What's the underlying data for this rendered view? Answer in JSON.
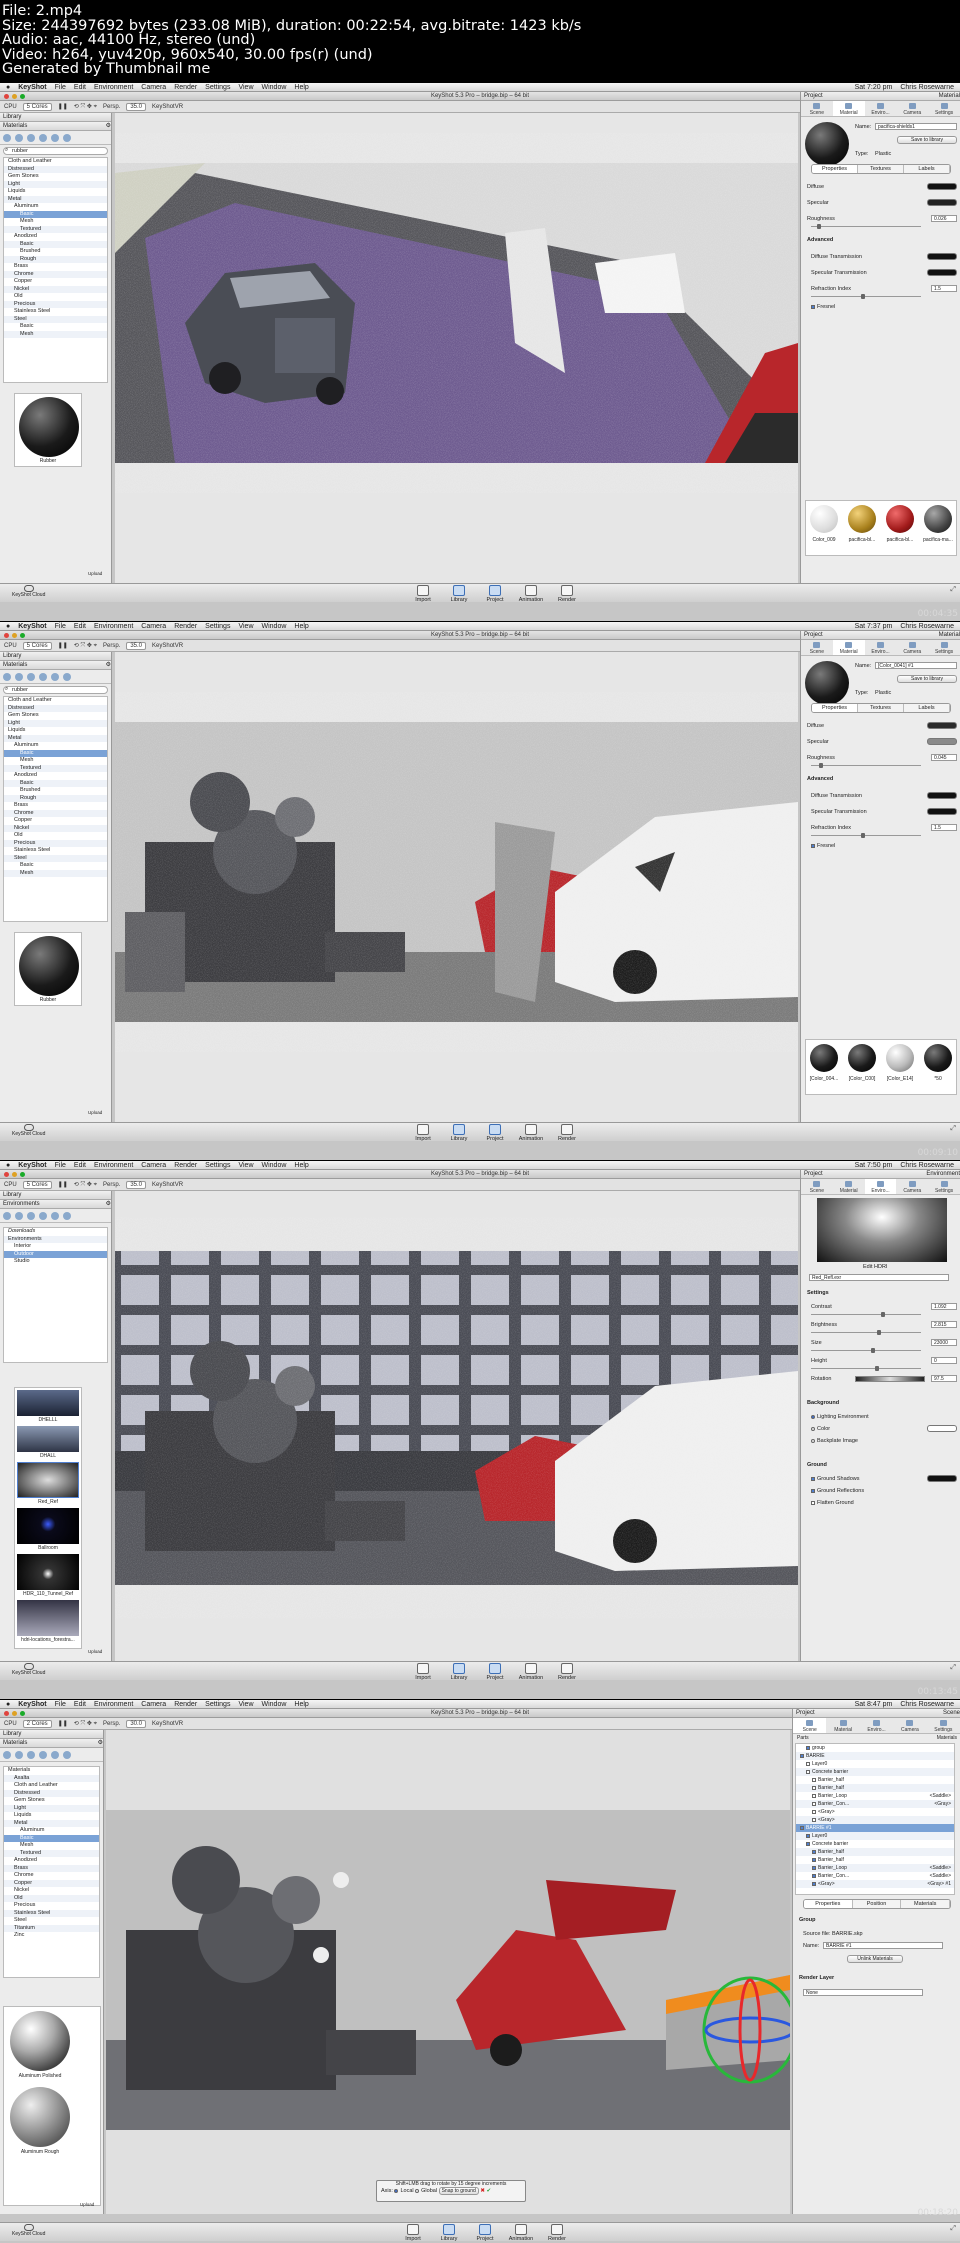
{
  "header": {
    "lines": [
      "File: 2.mp4",
      "Size: 244397692 bytes (233.08 MiB), duration: 00:22:54, avg.bitrate: 1423 kb/s",
      "Audio: aac, 44100 Hz, stereo (und)",
      "Video: h264, yuv420p, 960x540, 30.00 fps(r) (und)",
      "Generated by Thumbnail me"
    ]
  },
  "menu": {
    "app": "KeyShot",
    "items": [
      "File",
      "Edit",
      "Environment",
      "Camera",
      "Render",
      "Settings",
      "View",
      "Window",
      "Help"
    ],
    "user": "Chris Rosewarne"
  },
  "toolbar": {
    "cpu": "CPU",
    "persp": "Persp.",
    "keyshotvr": "KeyShotVR"
  },
  "bottom": {
    "cloud": "KeyShot Cloud",
    "items": [
      "Import",
      "Library",
      "Project",
      "Animation",
      "Render"
    ]
  },
  "colors": {
    "accent": "#4f7fd0",
    "selection": "#7aa2d6",
    "mesh_red": "#b8262b"
  },
  "frames": [
    {
      "time_label": "Sat 7:20 pm",
      "timecode": "00:04:35",
      "window_title": "KeyShot 5.3 Pro – bridge.bip – 64 bit",
      "cores": "5 Cores",
      "persp_value": "35.0",
      "left": {
        "title": "Library",
        "tab": "Materials",
        "search": "rubber",
        "tree": [
          "Cloth and Leather",
          "Distressed",
          "Gem Stones",
          "Light",
          "Liquids",
          "Metal",
          "Aluminum",
          "Basic",
          "Mesh",
          "Textured",
          "Anodized",
          "Basic",
          "Brushed",
          "Rough",
          "Brass",
          "Chrome",
          "Copper",
          "Nickel",
          "Old",
          "Precious",
          "Stainless Steel",
          "Steel",
          "Basic",
          "Mesh"
        ],
        "thumb_label": "Rubber",
        "count": "Upload"
      },
      "right": {
        "title": "Project",
        "tab": "Material",
        "tabs": [
          "Scene",
          "Material",
          "Enviro...",
          "Camera",
          "Settings"
        ],
        "name_label": "Name:",
        "name_value": "pacifica-shields1",
        "save_btn": "Save to library",
        "type_label": "Type:",
        "type_value": "Plastic",
        "seg": [
          "Properties",
          "Textures",
          "Labels"
        ],
        "props": [
          "Diffuse",
          "Specular",
          "Roughness"
        ],
        "rough_value": "0.026",
        "advanced": "Advanced",
        "adv": [
          "Diffuse Transmission",
          "Specular Transmission",
          "Refraction Index"
        ],
        "ri_value": "1.5",
        "fresnel": "Fresnel",
        "swatches": [
          "Color_009",
          "pacifica-bl...",
          "pacifica-bl...",
          "pacifica-ma..."
        ]
      }
    },
    {
      "time_label": "Sat 7:37 pm",
      "timecode": "00:09:10",
      "window_title": "KeyShot 5.3 Pro – bridge.bip – 64 bit",
      "cores": "5 Cores",
      "persp_value": "35.0",
      "left": {
        "title": "Library",
        "tab": "Materials",
        "search": "rubber",
        "tree": [
          "Cloth and Leather",
          "Distressed",
          "Gem Stones",
          "Light",
          "Liquids",
          "Metal",
          "Aluminum",
          "Basic",
          "Mesh",
          "Textured",
          "Anodized",
          "Basic",
          "Brushed",
          "Rough",
          "Brass",
          "Chrome",
          "Copper",
          "Nickel",
          "Old",
          "Precious",
          "Stainless Steel",
          "Steel",
          "Basic",
          "Mesh"
        ],
        "thumb_label": "Rubber",
        "count": "Upload"
      },
      "right": {
        "title": "Project",
        "tab": "Material",
        "tabs": [
          "Scene",
          "Material",
          "Enviro...",
          "Camera",
          "Settings"
        ],
        "name_label": "Name:",
        "name_value": "[Color_0041] #1",
        "save_btn": "Save to library",
        "type_label": "Type:",
        "type_value": "Plastic",
        "seg": [
          "Properties",
          "Textures",
          "Labels"
        ],
        "props": [
          "Diffuse",
          "Specular",
          "Roughness"
        ],
        "rough_value": "0.045",
        "advanced": "Advanced",
        "adv": [
          "Diffuse Transmission",
          "Specular Transmission",
          "Refraction Index"
        ],
        "ri_value": "1.5",
        "fresnel": "Fresnel",
        "swatches": [
          "[Color_004...",
          "[Color_C00]",
          "[Color_E14]",
          "*50"
        ]
      }
    },
    {
      "time_label": "Sat 7:50 pm",
      "timecode": "00:13:45",
      "window_title": "KeyShot 5.3 Pro – bridge.bip – 64 bit",
      "cores": "5 Cores",
      "persp_value": "35.0",
      "left": {
        "title": "Library",
        "tab": "Environments",
        "tree": [
          "Downloads",
          "Environments",
          "Interior",
          "Outdoor",
          "Studio"
        ],
        "thumbs": [
          "DHELLL",
          "DHALL",
          "Red_Ref",
          "Ballroom",
          "HDR_110_Tunnel_Ref",
          "hdri-locations_forestra..."
        ],
        "count": "Upload"
      },
      "right": {
        "title": "Project",
        "tab": "Environment",
        "tabs": [
          "Scene",
          "Material",
          "Enviro...",
          "Camera",
          "Settings"
        ],
        "edit_hdri": "Edit HDRI",
        "env_name": "Red_Refl.exr",
        "settings": "Settings",
        "rows": [
          {
            "label": "Contrast",
            "value": "1.092"
          },
          {
            "label": "Brightness",
            "value": "2.815"
          },
          {
            "label": "Size",
            "value": "23000"
          },
          {
            "label": "Height",
            "value": "0"
          },
          {
            "label": "Rotation",
            "value": "97.5"
          }
        ],
        "background": "Background",
        "bg_opts": [
          "Lighting Environment",
          "Color",
          "Backplate Image"
        ],
        "ground": "Ground",
        "ground_opts": [
          "Ground Shadows",
          "Ground Reflections",
          "Flatten Ground"
        ]
      }
    },
    {
      "time_label": "Sat 8:47 pm",
      "timecode": "00:18:20",
      "window_title": "KeyShot 5.3 Pro – bridge.bip – 64 bit",
      "cores": "2 Cores",
      "persp_value": "30.0",
      "left": {
        "title": "Library",
        "tab": "Materials",
        "tree": [
          "Materials",
          "Axalta",
          "Cloth and Leather",
          "Distressed",
          "Gem Stones",
          "Light",
          "Liquids",
          "Metal",
          "Aluminum",
          "Basic",
          "Mesh",
          "Textured",
          "Anodized",
          "Brass",
          "Chrome",
          "Copper",
          "Nickel",
          "Old",
          "Precious",
          "Stainless Steel",
          "Steel",
          "Titanium",
          "Zinc"
        ],
        "thumbs": [
          "Aluminum Polished",
          "Aluminum Rough"
        ],
        "count": "Upload"
      },
      "right": {
        "title": "Project",
        "tab": "Scene",
        "tabs": [
          "Scene",
          "Material",
          "Enviro...",
          "Camera",
          "Settings"
        ],
        "col_parts": "Parts",
        "col_materials": "Materials",
        "tree": [
          "group",
          "BARRIE",
          "Layer0",
          "Concrete barrier",
          "Barrier_half",
          "Barrier_half",
          "Barrier_Loop",
          "Barrier_Con...",
          "<Gray>",
          "<Gray>",
          "BARRIE #1",
          "Layer0",
          "Concrete barrier",
          "Barrier_half",
          "Barrier_half",
          "Barrier_Loop",
          "Barrier_Con...",
          "<Gray>"
        ],
        "mat_tags": [
          "<Saddle>",
          "<Gray>",
          "<Saddle>",
          "<Saddle>",
          "<Gray> #1"
        ],
        "seg": [
          "Properties",
          "Position",
          "Materials"
        ],
        "group": "Group",
        "source": "Source file: BARRIE.skp",
        "name_label": "Name:",
        "name_value": "BARRIE #1",
        "unlink": "Unlink Materials",
        "render_layer": "Render Layer",
        "layer_value": "None"
      },
      "hint": {
        "text": "Shift+LMB drag to rotate by 15 degree increments",
        "axis": "Axis:",
        "local": "Local",
        "global": "Global",
        "snap": "Snap to ground"
      }
    }
  ]
}
